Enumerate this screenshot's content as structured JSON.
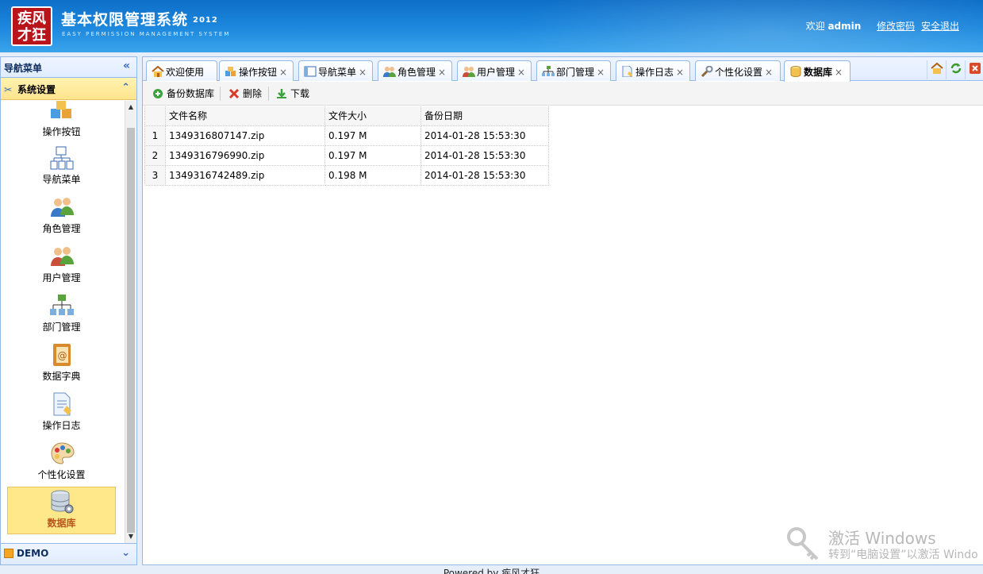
{
  "header": {
    "logo_text": "疾风才狂",
    "title": "基本权限管理系统",
    "year": "2012",
    "subtitle": "EASY PERMISSION MANAGEMENT SYSTEM",
    "welcome": "欢迎",
    "username": "admin",
    "change_password": "修改密码",
    "logout": "安全退出"
  },
  "sidebar": {
    "title": "导航菜单",
    "section": "系统设置",
    "items": [
      {
        "label": "操作按钮",
        "icon": "cubes-icon"
      },
      {
        "label": "导航菜单",
        "icon": "sitemap-doc-icon"
      },
      {
        "label": "角色管理",
        "icon": "users-icon"
      },
      {
        "label": "用户管理",
        "icon": "users-icon"
      },
      {
        "label": "部门管理",
        "icon": "org-chart-icon"
      },
      {
        "label": "数据字典",
        "icon": "address-book-icon"
      },
      {
        "label": "操作日志",
        "icon": "doc-edit-icon"
      },
      {
        "label": "个性化设置",
        "icon": "palette-icon"
      },
      {
        "label": "数据库",
        "icon": "database-gear-icon",
        "active": true
      }
    ],
    "demo_section": "DEMO"
  },
  "tabs": [
    {
      "label": "欢迎使用",
      "icon": "home-icon",
      "closable": false
    },
    {
      "label": "操作按钮",
      "icon": "cubes-icon",
      "closable": true
    },
    {
      "label": "导航菜单",
      "icon": "window-icon",
      "closable": true
    },
    {
      "label": "角色管理",
      "icon": "users-icon",
      "closable": true
    },
    {
      "label": "用户管理",
      "icon": "users-icon",
      "closable": true
    },
    {
      "label": "部门管理",
      "icon": "org-chart-icon",
      "closable": true
    },
    {
      "label": "操作日志",
      "icon": "doc-edit-icon",
      "closable": true
    },
    {
      "label": "个性化设置",
      "icon": "wrench-icon",
      "closable": true
    },
    {
      "label": "数据库",
      "icon": "database-icon",
      "closable": true,
      "active": true
    }
  ],
  "tab_tools": [
    "home-icon",
    "refresh-icon",
    "close-all-icon"
  ],
  "toolbar": {
    "backup": "备份数据库",
    "delete": "删除",
    "download": "下载"
  },
  "grid": {
    "columns": [
      "文件名称",
      "文件大小",
      "备份日期"
    ],
    "rows": [
      {
        "n": "1",
        "name": "1349316807147.zip",
        "size": "0.197 M",
        "date": "2014-01-28 15:53:30"
      },
      {
        "n": "2",
        "name": "1349316796990.zip",
        "size": "0.197 M",
        "date": "2014-01-28 15:53:30"
      },
      {
        "n": "3",
        "name": "1349316742489.zip",
        "size": "0.198 M",
        "date": "2014-01-28 15:53:30"
      }
    ]
  },
  "watermark": {
    "line1": "激活 Windows",
    "line2": "转到“电脑设置”以激活 Windo"
  },
  "footer": "Powered by 疾风才狂"
}
